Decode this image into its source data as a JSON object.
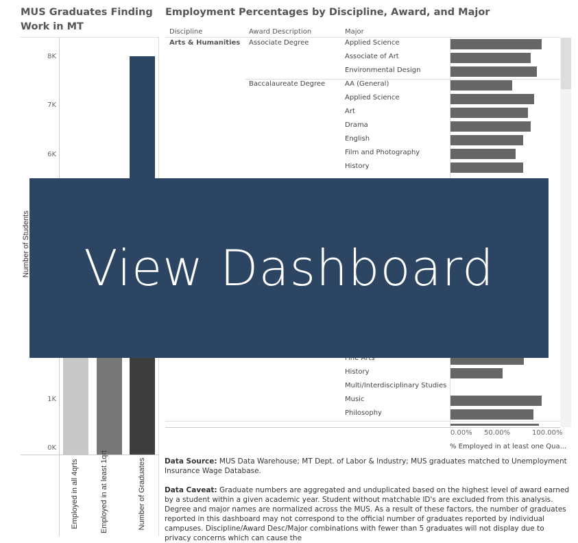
{
  "left_panel": {
    "title": "MUS Graduates Finding Work in MT",
    "y_axis_label": "Number of Students",
    "y_ticks": [
      "8K",
      "7K",
      "6K",
      "1K",
      "0K"
    ]
  },
  "right_panel": {
    "title": "Employment Percentages by Discipline, Award, and Major",
    "headers": {
      "discipline": "Discipline",
      "award": "Award Description",
      "major": "Major"
    },
    "discipline": "Arts & Humanities",
    "awards": [
      "Associate Degree",
      "Baccalaureate Degree"
    ],
    "x_ticks": [
      "0.00%",
      "50.00%",
      "100.00%"
    ],
    "x_axis_label": "% Employed in at least one Qua..."
  },
  "overlay": {
    "label": "View Dashboard",
    "color": "#2b4562"
  },
  "footer": {
    "source_label": "Data Source:",
    "source_text": " MUS Data Warehouse; MT Dept. of Labor & Industry; MUS graduates matched to Unemployment Insurance Wage Database.",
    "caveat_label": "Data Caveat:",
    "caveat_text": " Graduate numbers are aggregated and unduplicated based on the highest level of award earned by a student within a given academic year. Student without matchable ID's are excluded from this analysis. Degree and major names are normalized across the MUS. As a result of these factors, the number of graduates reported in this dashboard may not correspond to the official number of graduates reported by individual campuses.   Discipline/Award Desc/Major combinations with fewer than 5 graduates will not display due to privacy concerns which can cause the"
  },
  "chart_data": [
    {
      "type": "bar",
      "title": "MUS Graduates Finding Work in MT",
      "ylabel": "Number of Students",
      "categories": [
        "Employed in all 4qrts",
        "Employed in at least 1qrt",
        "Number of Graduates"
      ],
      "values": [
        null,
        null,
        8020
      ],
      "colors": [
        "#c8c8c8",
        "#777777",
        "#3d3d3d"
      ],
      "ylim": [
        0,
        8400
      ],
      "note_visible_min": [
        1900,
        1900,
        8020
      ]
    },
    {
      "type": "bar",
      "orientation": "horizontal",
      "xlabel": "% Employed in at least one Qua...",
      "xlim": [
        0,
        100
      ],
      "rows_top": [
        {
          "award": "Associate Degree",
          "major": "Applied Science",
          "value": 96
        },
        {
          "award": "Associate Degree",
          "major": "Associate of Art",
          "value": 84
        },
        {
          "award": "Associate Degree",
          "major": "Environmental Design",
          "value": 91
        },
        {
          "award": "Baccalaureate Degree",
          "major": "AA (General)",
          "value": 65
        },
        {
          "award": "Baccalaureate Degree",
          "major": "Applied Science",
          "value": 88
        },
        {
          "award": "Baccalaureate Degree",
          "major": "Art",
          "value": 81
        },
        {
          "award": "Baccalaureate Degree",
          "major": "Drama",
          "value": 84
        },
        {
          "award": "Baccalaureate Degree",
          "major": "English",
          "value": 76
        },
        {
          "award": "Baccalaureate Degree",
          "major": "Film and Photography",
          "value": 68
        },
        {
          "award": "Baccalaureate Degree",
          "major": "History",
          "value": 76
        }
      ],
      "rows_bottom": [
        {
          "major": "Fine Arts",
          "value": 77
        },
        {
          "major": "History",
          "value": 55
        },
        {
          "major": "Multi/Interdisciplinary Studies",
          "value": null
        },
        {
          "major": "Music",
          "value": 96
        },
        {
          "major": "Philosophy",
          "value": 87
        }
      ]
    }
  ]
}
